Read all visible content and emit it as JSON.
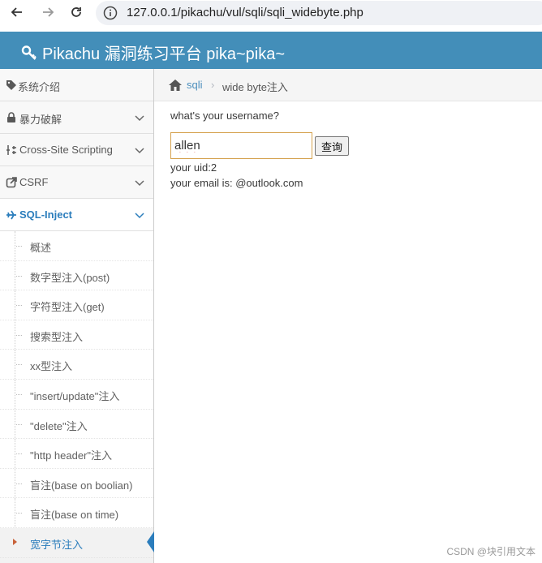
{
  "browser": {
    "url": "127.0.0.1/pikachu/vul/sqli/sqli_widebyte.php"
  },
  "header": {
    "title": "Pikachu 漏洞练习平台 pika~pika~",
    "background_color": "#438eb9"
  },
  "sidebar": {
    "items": [
      {
        "label": "系统介绍",
        "icon": "tag-icon"
      },
      {
        "label": "暴力破解",
        "icon": "lock-icon"
      },
      {
        "label": "Cross-Site Scripting",
        "icon": "sliders-icon"
      },
      {
        "label": "CSRF",
        "icon": "external-link-icon"
      },
      {
        "label": "SQL-Inject",
        "icon": "plane-icon"
      }
    ],
    "submenu": [
      {
        "label": "概述"
      },
      {
        "label": "数字型注入(post)"
      },
      {
        "label": "字符型注入(get)"
      },
      {
        "label": "搜索型注入"
      },
      {
        "label": "xx型注入"
      },
      {
        "label": "\"insert/update\"注入"
      },
      {
        "label": "\"delete\"注入"
      },
      {
        "label": "\"http header\"注入"
      },
      {
        "label": "盲注(base on boolian)"
      },
      {
        "label": "盲注(base on time)"
      },
      {
        "label": "宽字节注入"
      }
    ],
    "active_color": "#2b7dbc"
  },
  "breadcrumb": {
    "link": "sqli",
    "separator": "›",
    "current": "wide byte注入"
  },
  "form": {
    "prompt": "what's your username?",
    "username_value": "allen",
    "submit_label": "查询"
  },
  "result": {
    "uid_line": "your uid:2",
    "email_line": "your email is: @outlook.com"
  },
  "watermark": "CSDN @块引用文本"
}
